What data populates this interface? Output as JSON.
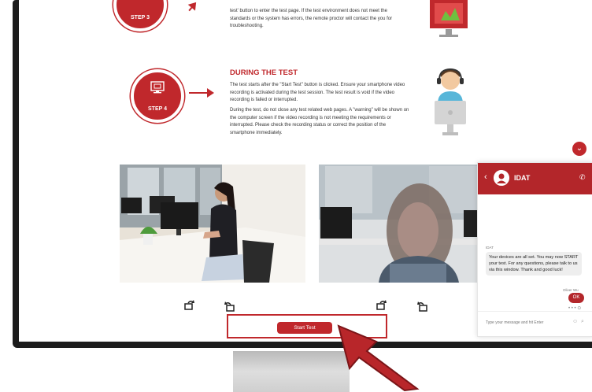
{
  "steps": [
    {
      "label": "STEP 3",
      "text": [
        "test' button to enter the test page. If the test environment does not meet the",
        "standards or the system has errors, the remote proctor will contact the you for",
        "troubleshooting."
      ]
    },
    {
      "label": "STEP 4",
      "title": "DURING THE TEST",
      "paragraph1": [
        "The test starts after the \"Start Test\" button is clicked. Ensure your smartphone video",
        "recording is activated during the test session. The test result is void if the video",
        "recording is failed or interrupted."
      ],
      "paragraph2": [
        "During the test, do not close any test related web pages. A \"warning\" will be shown on",
        "the computer screen if the video recording is not meeting the requirements or",
        "interrupted. Please check the recording status or correct the position of the",
        "smartphone immediately."
      ]
    }
  ],
  "start_button": {
    "label": "Start Test"
  },
  "chat": {
    "title": "IDAT",
    "sender": "IDAT",
    "message": "Your devices are all set. You may now START your test. For any questions, please talk to us via this window. Thank and good luck!",
    "user_name": "Oliver Wu",
    "user_reply": "OK",
    "input_placeholder": "Type your message and hit Enter"
  },
  "colors": {
    "accent": "#c0282c",
    "chat_header": "#b3262a"
  },
  "icons": [
    "camera-icon",
    "monitor-icon",
    "rotate-right-icon",
    "rotate-left-icon",
    "phone-icon",
    "chevron-down-icon",
    "back-icon",
    "cursor-arrow-icon"
  ]
}
